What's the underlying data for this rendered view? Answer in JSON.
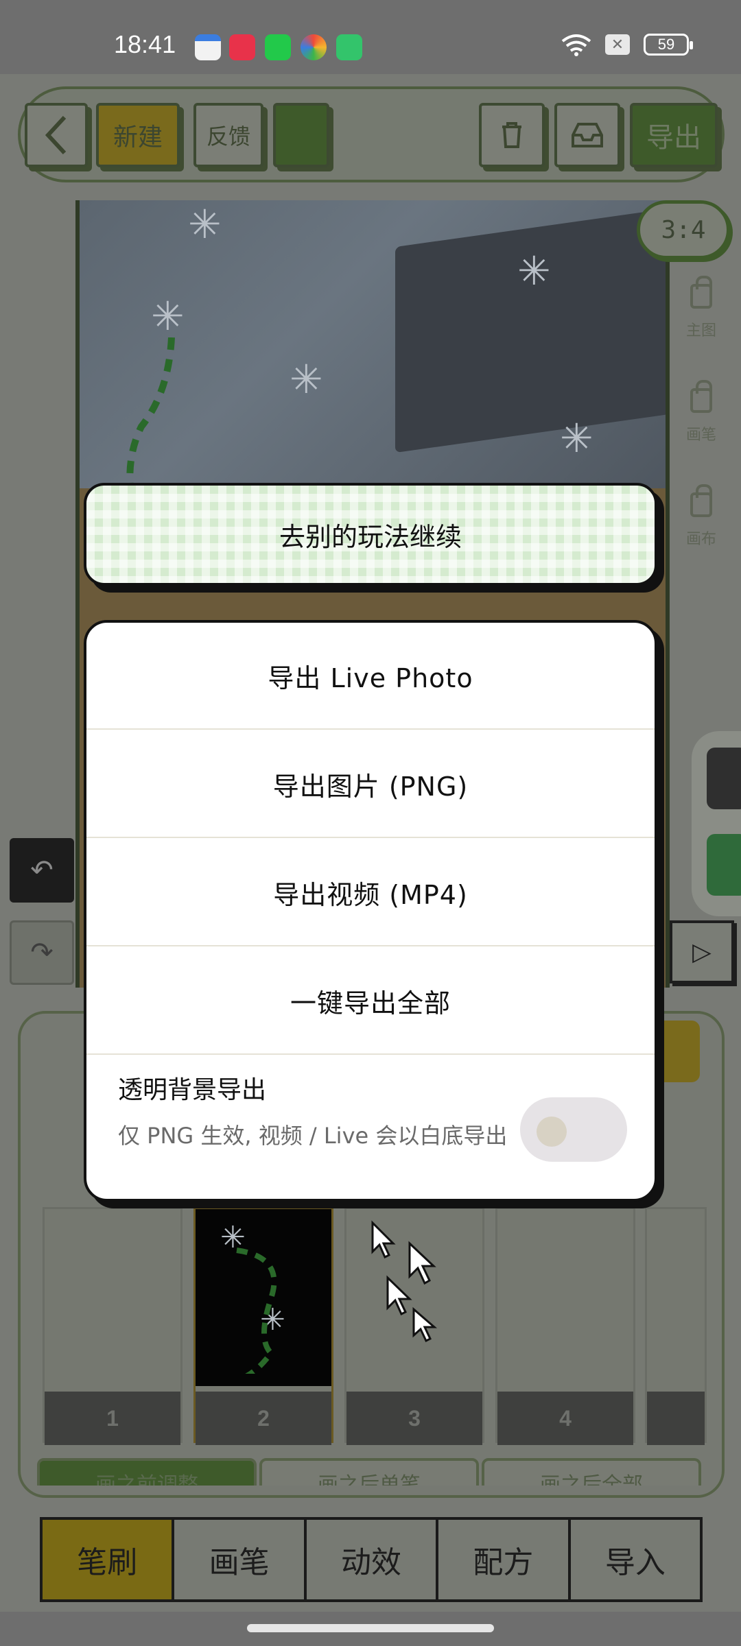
{
  "status_bar": {
    "time": "18:41",
    "apps": [
      {
        "icon": "wallet-app-icon",
        "color": "#e8e8e8"
      },
      {
        "icon": "xiaohongshu-app-icon",
        "color": "#e8324a"
      },
      {
        "icon": "green-app-icon",
        "color": "#22c94a"
      },
      {
        "icon": "colorful-app-icon",
        "color": "#f0a030"
      },
      {
        "icon": "upload-app-icon",
        "color": "#33c46b"
      }
    ],
    "battery": "59"
  },
  "toolbar": {
    "new_label": "新建",
    "feedback_label": "反馈",
    "export_label": "导出"
  },
  "canvas": {
    "ratio": "3:4"
  },
  "side_locks": [
    {
      "label": "主图"
    },
    {
      "label": "画笔"
    },
    {
      "label": "画布"
    }
  ],
  "tiles": [
    "1",
    "2",
    "3",
    "4"
  ],
  "subtabs": [
    "画之前调整",
    "画之后单笔",
    "画之后全部"
  ],
  "bottom_tabs": [
    "笔刷",
    "画笔",
    "动效",
    "配方",
    "导入"
  ],
  "modal": {
    "continue_label": "去别的玩法继续",
    "options": [
      "导出 Live Photo",
      "导出图片 (PNG)",
      "导出视频 (MP4)",
      "一键导出全部"
    ],
    "transparent": {
      "title": "透明背景导出",
      "description": "仅 PNG 生效, 视频 / Live 会以白底导出",
      "enabled": false
    }
  },
  "colors": {
    "accent_green": "#3e5a2a",
    "accent_gold": "#7a6a14",
    "continue_bg": "#d5ebcf"
  }
}
